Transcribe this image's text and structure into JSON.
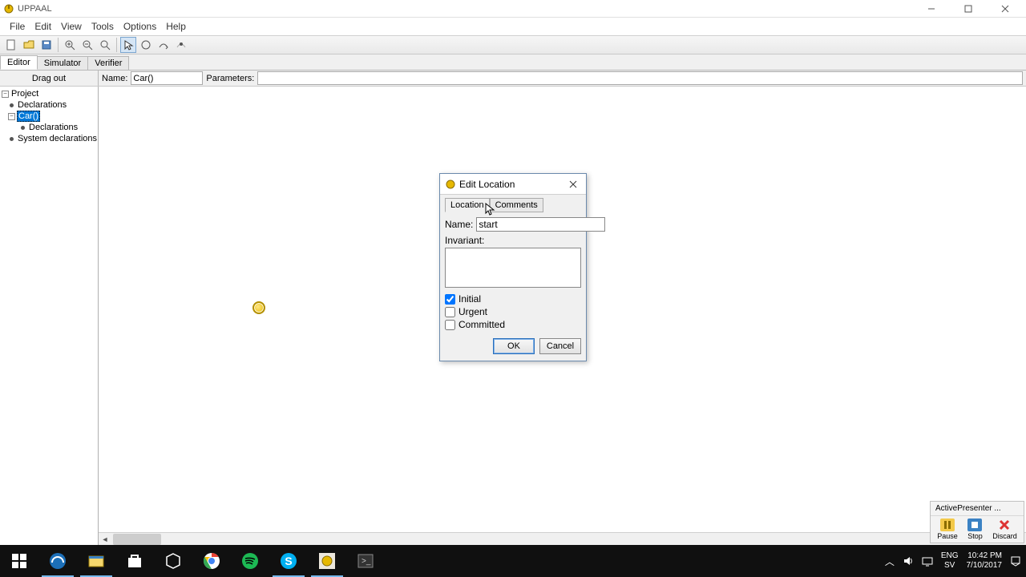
{
  "titlebar": {
    "app_name": "UPPAAL"
  },
  "menu": {
    "file": "File",
    "edit": "Edit",
    "view": "View",
    "tools": "Tools",
    "options": "Options",
    "help": "Help"
  },
  "tabs": {
    "editor": "Editor",
    "simulator": "Simulator",
    "verifier": "Verifier"
  },
  "subbar": {
    "drag_out": "Drag out",
    "name_label": "Name:",
    "name_value": "Car()",
    "params_label": "Parameters:",
    "params_value": ""
  },
  "tree": {
    "project": "Project",
    "declarations": "Declarations",
    "car": "Car()",
    "car_declarations": "Declarations",
    "system_declarations": "System declarations"
  },
  "dialog": {
    "title": "Edit Location",
    "tab_location": "Location",
    "tab_comments": "Comments",
    "name_label": "Name:",
    "name_value": "start",
    "invariant_label": "Invariant:",
    "invariant_value": "",
    "check_initial": "Initial",
    "check_urgent": "Urgent",
    "check_committed": "Committed",
    "ok": "OK",
    "cancel": "Cancel"
  },
  "ap": {
    "title": "ActivePresenter ...",
    "pause": "Pause",
    "stop": "Stop",
    "discard": "Discard"
  },
  "tray": {
    "lang1": "ENG",
    "lang2": "SV",
    "time": "10:42 PM",
    "date": "7/10/2017"
  }
}
